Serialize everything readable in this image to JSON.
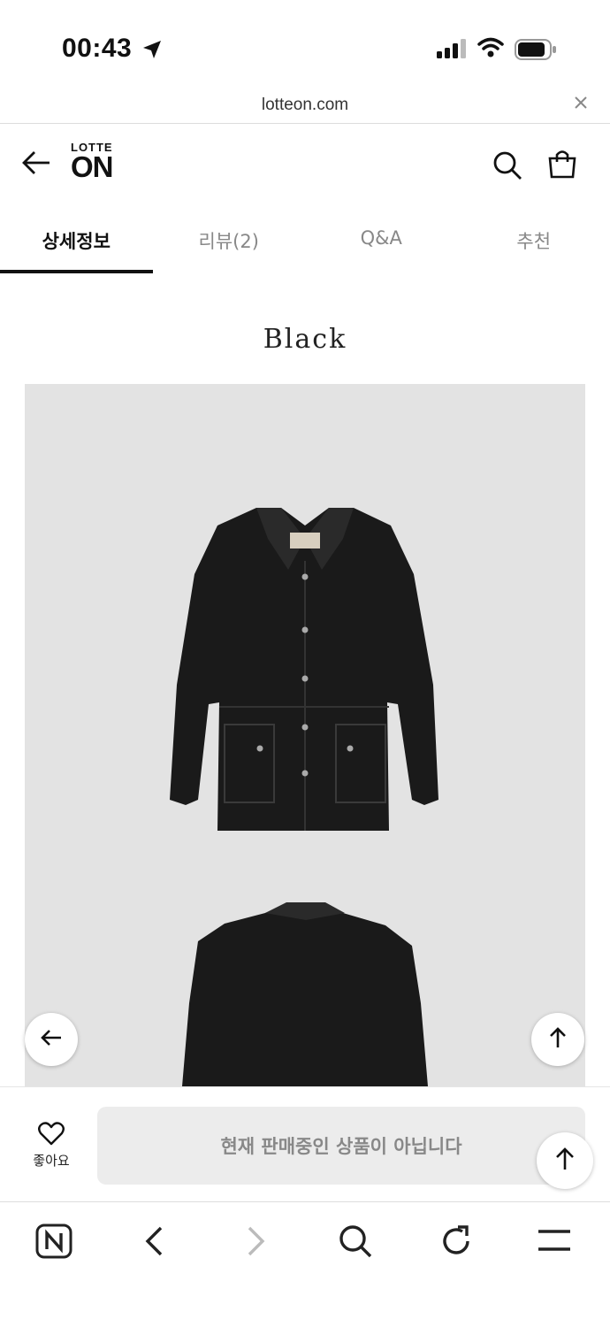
{
  "status_bar": {
    "time": "00:43"
  },
  "url_bar": {
    "url": "lotteon.com"
  },
  "header": {
    "logo_top": "LOTTE",
    "logo_bottom": "ON"
  },
  "tabs": [
    {
      "label": "상세정보",
      "active": true
    },
    {
      "label": "리뷰(2)",
      "active": false
    },
    {
      "label": "Q&A",
      "active": false
    },
    {
      "label": "추천",
      "active": false
    }
  ],
  "content": {
    "color_title": "Black"
  },
  "purchase_bar": {
    "like_label": "좋아요",
    "status_text": "현재 판매중인 상품이 아닙니다"
  },
  "icons": [
    "location-arrow-icon",
    "signal-icon",
    "wifi-icon",
    "battery-icon",
    "close-icon",
    "back-arrow-icon",
    "search-icon",
    "shopping-bag-icon",
    "heart-icon",
    "arrow-up-icon",
    "naver-icon",
    "chevron-left-icon",
    "chevron-right-icon",
    "refresh-icon",
    "menu-icon"
  ],
  "colors": {
    "accent": "#111111",
    "disabled_bg": "#ececec",
    "disabled_text": "#888888",
    "image_bg": "#e3e3e3"
  }
}
